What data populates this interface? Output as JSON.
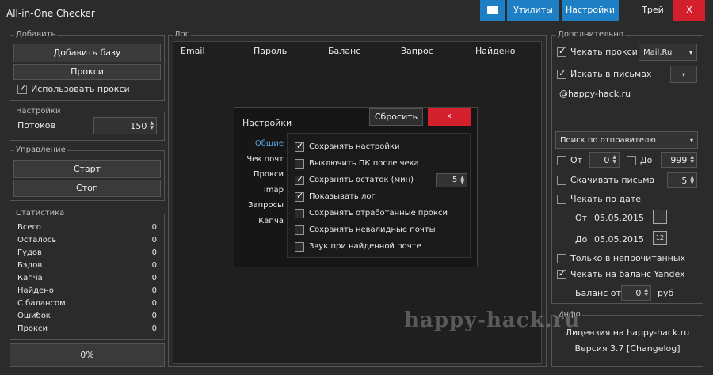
{
  "app": {
    "title": "All-in-One Checker"
  },
  "toolbar": {
    "utilities_label": "Утилиты",
    "settings_label": "Настройки",
    "tray_label": "Трей",
    "close_label": "X"
  },
  "left": {
    "add_group": {
      "label": "Добавить",
      "add_base": "Добавить базу",
      "proxy": "Прокси",
      "use_proxy": "Использовать прокси"
    },
    "settings_group": {
      "label": "Настройки",
      "threads_label": "Потоков",
      "threads_value": "150"
    },
    "control_group": {
      "label": "Управление",
      "start": "Старт",
      "stop": "Стоп"
    },
    "stats_group": {
      "label": "Статистика",
      "rows": [
        {
          "name": "Всего",
          "value": "0"
        },
        {
          "name": "Осталось",
          "value": "0"
        },
        {
          "name": "Гудов",
          "value": "0"
        },
        {
          "name": "Бэдов",
          "value": "0"
        },
        {
          "name": "Капча",
          "value": "0"
        },
        {
          "name": "Найдено",
          "value": "0"
        },
        {
          "name": "С балансом",
          "value": "0"
        },
        {
          "name": "Ошибок",
          "value": "0"
        },
        {
          "name": "Прокси",
          "value": "0"
        }
      ]
    },
    "progress": {
      "label": "0%",
      "value": 0
    }
  },
  "log": {
    "label": "Лог",
    "columns": [
      "Email",
      "Пароль",
      "Баланс",
      "Запрос",
      "Найдено"
    ]
  },
  "dialog": {
    "title": "Настройки",
    "reset_label": "Сбросить",
    "close_label": "x",
    "nav": [
      "Общие",
      "Чек почт",
      "Прокси",
      "Imap",
      "Запросы",
      "Капча"
    ],
    "options": [
      {
        "label": "Сохранять настройки",
        "checked": true
      },
      {
        "label": "Выключить ПК после чека",
        "checked": false
      },
      {
        "label": "Сохранять остаток (мин)",
        "checked": true,
        "value": "5"
      },
      {
        "label": "Показывать лог",
        "checked": true
      },
      {
        "label": "Сохранять отработанные прокси",
        "checked": false
      },
      {
        "label": "Сохранять невалидные почты",
        "checked": false
      },
      {
        "label": "Звук при найденной почте",
        "checked": false
      }
    ]
  },
  "right": {
    "extra_group": {
      "label": "Дополнительно",
      "check_proxy": "Чекать прокси",
      "proxy_service": "Mail.Ru",
      "search_in_letters": "Искать в письмах",
      "search_value": "@happy-hack.ru",
      "search_mode": "Поиск по отправителю",
      "from_label": "От",
      "from_value": "0",
      "to_label": "До",
      "to_value": "999",
      "download_letters": "Скачивать письма",
      "download_value": "5",
      "check_by_date": "Чекать по дате",
      "date_from_label": "От",
      "date_from": "05.05.2015",
      "date_to_label": "До",
      "date_to": "05.05.2015",
      "unread_only": "Только в непрочитанных",
      "check_yandex_balance": "Чекать на баланс Yandex",
      "balance_from_label": "Баланс от",
      "balance_value": "0",
      "balance_unit": "руб"
    },
    "info_group": {
      "label": "Инфо",
      "license": "Лицензия на happy-hack.ru",
      "version": "Версия 3.7 [Changelog]"
    }
  },
  "watermark": "happy-hack.ru"
}
